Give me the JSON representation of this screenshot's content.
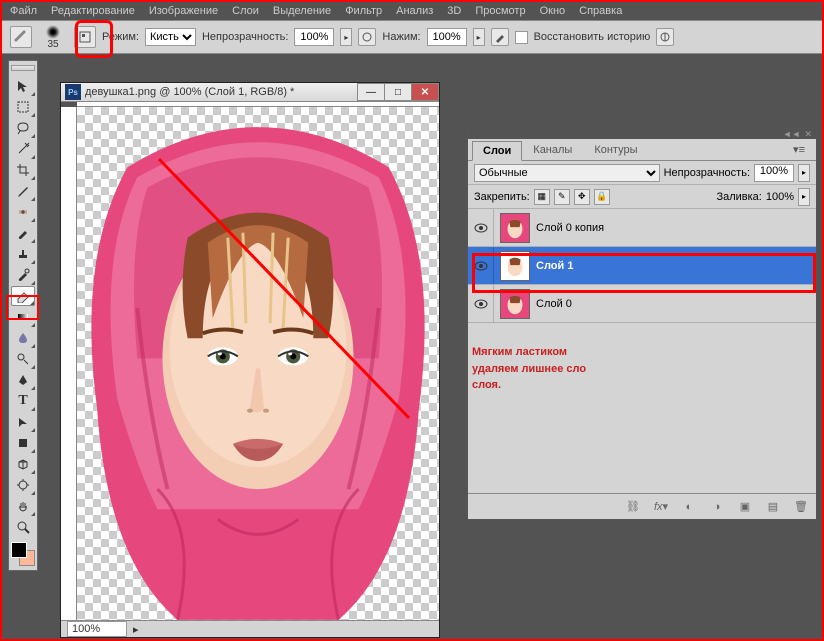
{
  "menu": {
    "items": [
      "Файл",
      "Редактирование",
      "Изображение",
      "Слои",
      "Выделение",
      "Фильтр",
      "Анализ",
      "3D",
      "Просмотр",
      "Окно",
      "Справка"
    ]
  },
  "options": {
    "brush_size": "35",
    "mode_label": "Режим:",
    "mode_value": "Кисть",
    "opacity_label": "Непрозрачность:",
    "opacity_value": "100%",
    "flow_label": "Нажим:",
    "flow_value": "100%",
    "restore_label": "Восстановить историю"
  },
  "doc": {
    "title": "девушка1.png @ 100% (Слой 1, RGB/8) *",
    "zoom": "100%"
  },
  "layers": {
    "tab_layers": "Слои",
    "tab_channels": "Каналы",
    "tab_paths": "Контуры",
    "blend": "Обычные",
    "opacity_label": "Непрозрачность:",
    "opacity": "100%",
    "lock_label": "Закрепить:",
    "fill_label": "Заливка:",
    "fill": "100%",
    "items": [
      {
        "name": "Слой 0 копия"
      },
      {
        "name": "Слой 1"
      },
      {
        "name": "Слой 0"
      }
    ]
  },
  "annotation": {
    "l1": "Мягким ластиком",
    "l2": "удаляем лишнее сло",
    "l3": "слоя."
  }
}
